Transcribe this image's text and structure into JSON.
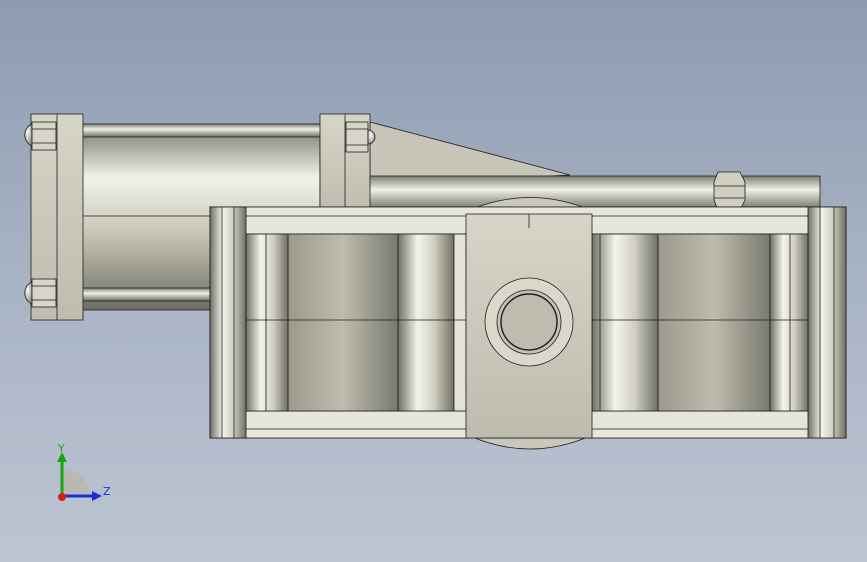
{
  "view": {
    "background_top": "#8e9bb0",
    "background_bottom": "#bcc5d3"
  },
  "model": {
    "description_colors": {
      "metal_light": "#e8e8dc",
      "metal_mid": "#c7c6b6",
      "metal_dark": "#7a7a70",
      "edge": "#1e1e1e"
    }
  },
  "triad": {
    "y_label": "Y",
    "z_label": "Z",
    "y_color": "#19a319",
    "z_color": "#1a2fd6",
    "x_color": "#d91c1c"
  }
}
